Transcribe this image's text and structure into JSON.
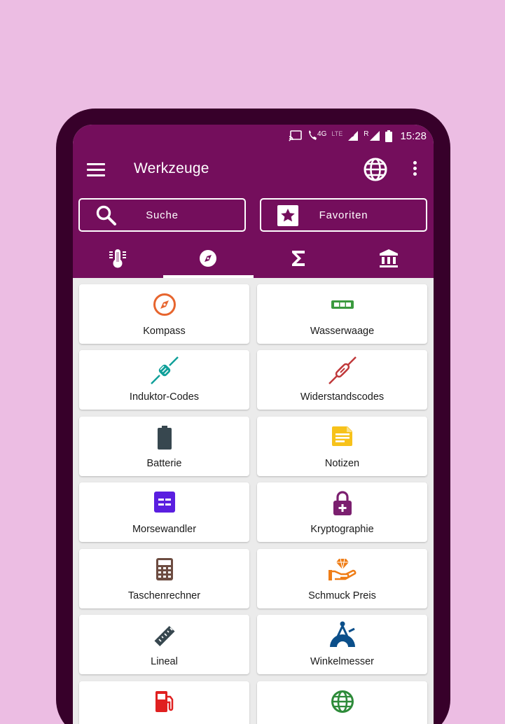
{
  "status_bar": {
    "network_label": "4G",
    "lte_label": "LTE",
    "roaming_label": "R",
    "time": "15:28"
  },
  "toolbar": {
    "title": "Werkzeuge"
  },
  "actions": {
    "search_label": "Suche",
    "favorites_label": "Favoriten"
  },
  "tabs": [
    {
      "icon": "thermometer-icon",
      "active": false
    },
    {
      "icon": "compass-icon",
      "active": true
    },
    {
      "icon": "sigma-icon",
      "active": false
    },
    {
      "icon": "bank-icon",
      "active": false
    }
  ],
  "tools": [
    {
      "label": "Kompass",
      "icon": "compass-icon",
      "color": "#e7652e"
    },
    {
      "label": "Wasserwaage",
      "icon": "level-icon",
      "color": "#3a9a3e"
    },
    {
      "label": "Induktor-Codes",
      "icon": "inductor-icon",
      "color": "#10a09a"
    },
    {
      "label": "Widerstandscodes",
      "icon": "resistor-icon",
      "color": "#c0393b"
    },
    {
      "label": "Batterie",
      "icon": "battery-icon",
      "color": "#37474f"
    },
    {
      "label": "Notizen",
      "icon": "note-icon",
      "color": "#f7c21a"
    },
    {
      "label": "Morsewandler",
      "icon": "morse-icon",
      "color": "#5a1ee0"
    },
    {
      "label": "Kryptographie",
      "icon": "lock-icon",
      "color": "#7b1f6f"
    },
    {
      "label": "Taschenrechner",
      "icon": "calculator-icon",
      "color": "#6d4c41"
    },
    {
      "label": "Schmuck Preis",
      "icon": "jewelry-icon",
      "color": "#ef7d16"
    },
    {
      "label": "Lineal",
      "icon": "ruler-icon",
      "color": "#37474f"
    },
    {
      "label": "Winkelmesser",
      "icon": "protractor-icon",
      "color": "#0b4f8a"
    },
    {
      "label": "",
      "icon": "fuel-icon",
      "color": "#e02020"
    },
    {
      "label": "",
      "icon": "globe-icon",
      "color": "#2e8b3a"
    }
  ],
  "colors": {
    "appbar": "#740e5c",
    "page_bg": "#ecbde3",
    "phone": "#37002a"
  }
}
